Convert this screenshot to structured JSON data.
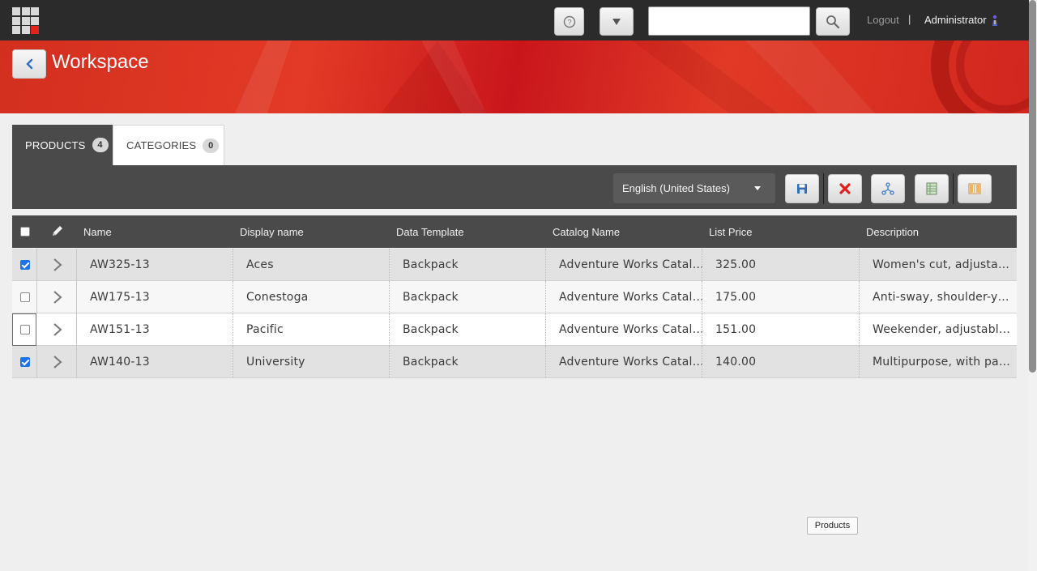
{
  "header": {
    "logout_label": "Logout",
    "separator": "|",
    "user_name": "Administrator",
    "search": {
      "placeholder": "",
      "value": ""
    }
  },
  "banner": {
    "title": "Workspace"
  },
  "tabs": [
    {
      "label": "PRODUCTS",
      "count": "4",
      "active": true
    },
    {
      "label": "CATEGORIES",
      "count": "0",
      "active": false
    }
  ],
  "toolbar": {
    "language": "English (United States)",
    "buttons": [
      "save-icon",
      "delete-icon",
      "hierarchy-icon",
      "spreadsheet-icon",
      "columns-icon"
    ]
  },
  "grid": {
    "columns": [
      "Name",
      "Display name",
      "Data Template",
      "Catalog Name",
      "List Price",
      "Description"
    ],
    "rows": [
      {
        "checked": true,
        "name": "AW325-13",
        "display": "Aces",
        "template": "Backpack",
        "catalog": "Adventure Works Catalog",
        "price": "325.00",
        "description": "Women's cut, adjustable straps"
      },
      {
        "checked": false,
        "name": "AW175-13",
        "display": "Conestoga",
        "template": "Backpack",
        "catalog": "Adventure Works Catalog",
        "price": "175.00",
        "description": "Anti-sway, shoulder-yoke straps"
      },
      {
        "checked": false,
        "name": "AW151-13",
        "display": "Pacific",
        "template": "Backpack",
        "catalog": "Adventure Works Catalog",
        "price": "151.00",
        "description": "Weekender, adjustable straps"
      },
      {
        "checked": true,
        "name": "AW140-13",
        "display": "University",
        "template": "Backpack",
        "catalog": "Adventure Works Catalog",
        "price": "140.00",
        "description": "Multipurpose, with padded laptop sleeve"
      }
    ]
  },
  "tooltip": "Products",
  "colors": {
    "topbar": "#2b2b2b",
    "banner": "#d32f1f",
    "toolbar": "#4a4a4a",
    "checkbox": "#1a73e8"
  }
}
